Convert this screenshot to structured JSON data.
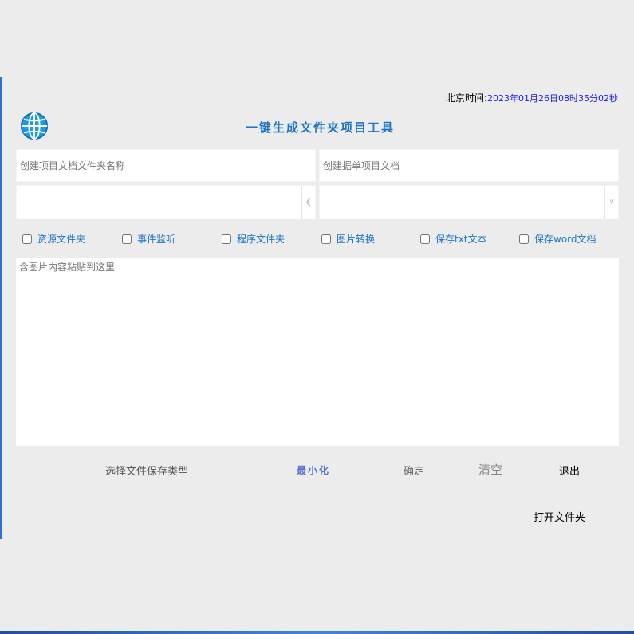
{
  "header": {
    "time_label": "北京时间:",
    "time_value": "2023年01月26日08时35分02秒",
    "app_title": "一键生成文件夹项目工具"
  },
  "inputs": {
    "folder_name_placeholder": "创建项目文档文件夹名称",
    "single_doc_placeholder": "创建据单项目文档"
  },
  "checkboxes": [
    {
      "label": "资源文件夹",
      "checked": false
    },
    {
      "label": "事件监听",
      "checked": false
    },
    {
      "label": "程序文件夹",
      "checked": false
    },
    {
      "label": "图片转换",
      "checked": false
    },
    {
      "label": "保存txt文本",
      "checked": false
    },
    {
      "label": "保存word文档",
      "checked": false
    }
  ],
  "paste_area": {
    "placeholder": "含图片内容粘贴到这里"
  },
  "buttons": {
    "save_type": "选择文件保存类型",
    "minimize": "最小化",
    "confirm": "确定",
    "clear": "清空",
    "exit": "退出",
    "open_folder": "打开文件夹"
  },
  "colors": {
    "accent": "#1d74c8",
    "time_value": "#1a1aff",
    "background": "#ececec"
  }
}
